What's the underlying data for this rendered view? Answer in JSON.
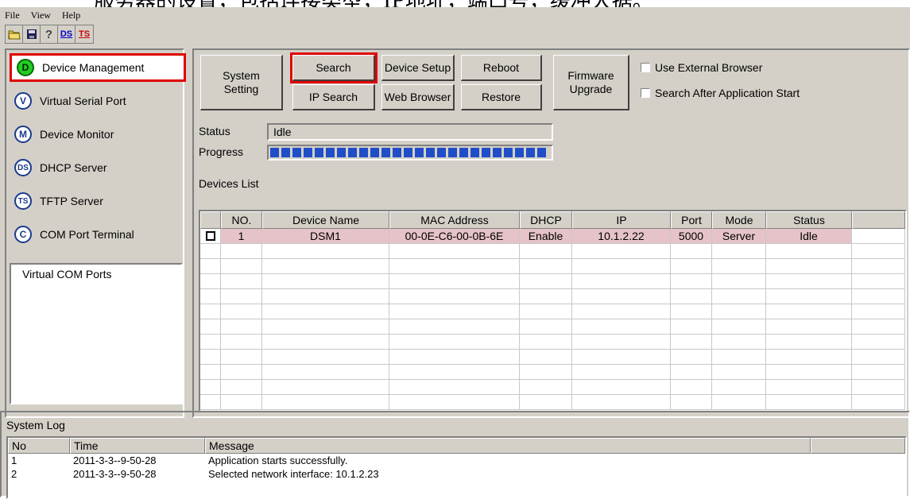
{
  "document_text": "服务器的设置，包括连接类型，IP地址，端口号，缓冲大据。",
  "menu": [
    "File",
    "View",
    "Help"
  ],
  "toolbar": {
    "ds": "DS",
    "ts": "TS"
  },
  "nav": [
    {
      "icon": "D",
      "label": "Device Management",
      "active": true
    },
    {
      "icon": "V",
      "label": "Virtual Serial Port"
    },
    {
      "icon": "M",
      "label": "Device Monitor"
    },
    {
      "icon": "DS",
      "label": "DHCP Server"
    },
    {
      "icon": "TS",
      "label": "TFTP Server"
    },
    {
      "icon": "C",
      "label": "COM Port Terminal"
    }
  ],
  "tree": {
    "root": "Virtual COM Ports"
  },
  "buttons": {
    "system_setting_1": "System",
    "system_setting_2": "Setting",
    "search": "Search",
    "ip_search": "IP Search",
    "device_setup": "Device Setup",
    "web_browser": "Web Browser",
    "reboot": "Reboot",
    "restore": "Restore",
    "firmware_1": "Firmware",
    "firmware_2": "Upgrade"
  },
  "options": {
    "external_browser": "Use External Browser",
    "search_after_start": "Search After Application Start"
  },
  "status": {
    "label": "Status",
    "value": "Idle"
  },
  "progress": {
    "label": "Progress",
    "value": 1.0
  },
  "devices": {
    "title": "Devices List",
    "columns": [
      "",
      "NO.",
      "Device Name",
      "MAC Address",
      "DHCP",
      "IP",
      "Port",
      "Mode",
      "Status",
      ""
    ],
    "rows": [
      {
        "no": "1",
        "name": "DSM1",
        "mac": "00-0E-C6-00-0B-6E",
        "dhcp": "Enable",
        "ip": "10.1.2.22",
        "port": "5000",
        "mode": "Server",
        "status": "Idle"
      }
    ]
  },
  "syslog": {
    "title": "System Log",
    "columns": [
      "No",
      "Time",
      "Message"
    ],
    "rows": [
      {
        "no": "1",
        "time": "2011-3-3--9-50-28",
        "message": "Application starts successfully."
      },
      {
        "no": "2",
        "time": "2011-3-3--9-50-28",
        "message": "Selected network interface: 10.1.2.23"
      }
    ]
  },
  "colors": {
    "selection_outline": "#e00000",
    "row_highlight": "#e6c3c8",
    "progress": "#1f4ec8",
    "window_bg": "#d4d0c8"
  }
}
